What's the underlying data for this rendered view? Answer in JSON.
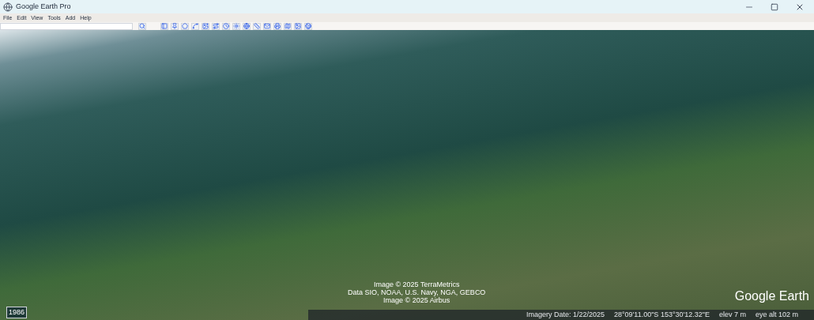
{
  "window": {
    "title": "Google Earth Pro"
  },
  "menu": [
    "File",
    "Edit",
    "View",
    "Tools",
    "Add",
    "Help"
  ],
  "map": {
    "credits": [
      "Image © 2025 TerraMetrics",
      "Data SIO, NOAA, U.S. Navy, NGA, GEBCO",
      "Image © 2025 Airbus"
    ],
    "logo": "Google Earth",
    "year": "1986"
  },
  "status_bar": {
    "imagery_date": "Imagery Date: 1/22/2025",
    "coordinates": "28°09'11.00\"S 153°30'12.32\"E",
    "elevation": "elev 7 m",
    "eye_alt": "eye alt 102 m"
  }
}
